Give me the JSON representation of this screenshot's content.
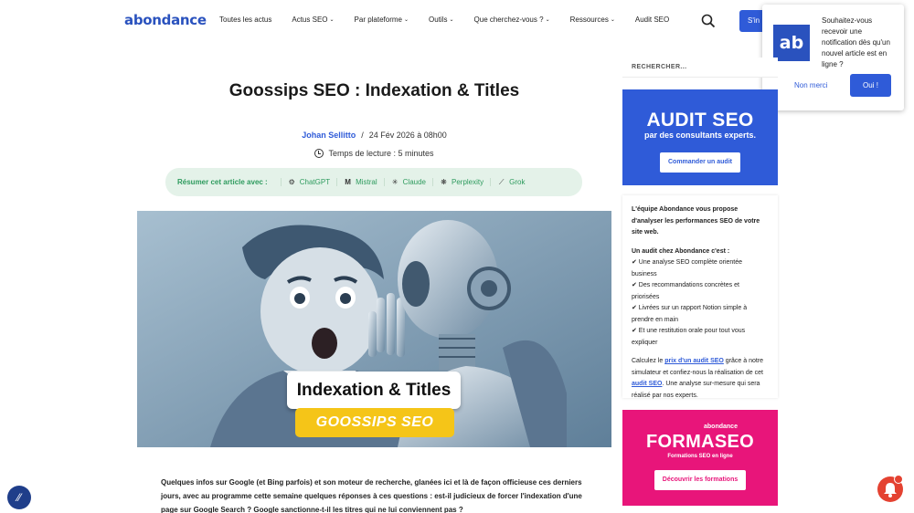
{
  "header": {
    "logo": "abondance",
    "nav": [
      {
        "label": "Toutes les actus",
        "dropdown": false
      },
      {
        "label": "Actus SEO",
        "dropdown": true
      },
      {
        "label": "Par plateforme",
        "dropdown": true
      },
      {
        "label": "Outils",
        "dropdown": true
      },
      {
        "label": "Que cherchez-vous ?",
        "dropdown": true
      },
      {
        "label": "Ressources",
        "dropdown": true
      },
      {
        "label": "Audit SEO",
        "dropdown": false
      }
    ],
    "signin_label": "S'in",
    "search_icon": "search-icon"
  },
  "notification": {
    "logo": "ab",
    "message": "Souhaitez-vous recevoir une notification dès qu'un nouvel article est en ligne ?",
    "no_label": "Non merci",
    "yes_label": "Oui !"
  },
  "article": {
    "title": "Goossips SEO : Indexation & Titles",
    "author": "Johan Sellitto",
    "date": "24 Fév 2026 à 08h00",
    "reading_time": "Temps de lecture : 5 minutes",
    "summarize_label": "Résumer cet article avec :",
    "ai_tools": [
      {
        "label": "ChatGPT",
        "icon": "chatgpt-icon"
      },
      {
        "label": "Mistral",
        "icon": "mistral-icon"
      },
      {
        "label": "Claude",
        "icon": "claude-icon"
      },
      {
        "label": "Perplexity",
        "icon": "perplexity-icon"
      },
      {
        "label": "Grok",
        "icon": "grok-icon"
      }
    ],
    "hero_badge": "Indexation & Titles",
    "hero_badge2": "GOOSSIPS SEO",
    "intro": "Quelques infos sur Google (et Bing parfois) et son moteur de recherche, glanées ici et là de façon officieuse ces derniers jours, avec au programme cette semaine quelques réponses à ces questions : est-il judicieux de forcer l'indexation d'une page sur Google Search ? Google sanctionne-t-il les titres qui ne lui conviennent pas ?"
  },
  "sidebar": {
    "search_placeholder": "RECHERCHER...",
    "audit_banner": {
      "title": "AUDIT SEO",
      "subtitle": "par des consultants experts.",
      "button": "Commander un audit"
    },
    "card": {
      "intro": "L'équipe Abondance vous propose d'analyser les performances SEO de votre site web.",
      "list_title": "Un audit chez Abondance c'est :",
      "items": [
        "✔ Une analyse SEO complète orientée business",
        "✔ Des recommandations concrètes et priorisées",
        "✔ Livrées sur un rapport Notion simple à prendre en main",
        "✔ Et une restitution orale pour tout vous expliquer"
      ],
      "outro_1": "Calculez le ",
      "outro_link1": "prix d'un audit SEO",
      "outro_2": " grâce à notre simulateur et confiez-nous la réalisation de cet ",
      "outro_link2": "audit SEO",
      "outro_3": ". Une analyse sur-mesure qui sera réalisé par nos experts."
    },
    "formation_banner": {
      "brand": "abondance",
      "title": "FORMASEO",
      "subtitle": "Formations SEO en ligne",
      "button": "Découvrir les formations"
    }
  },
  "colors": {
    "brand_blue": "#2f5bd8",
    "green": "#2e9b5e",
    "pink": "#e8157a",
    "yellow": "#f5c518"
  }
}
